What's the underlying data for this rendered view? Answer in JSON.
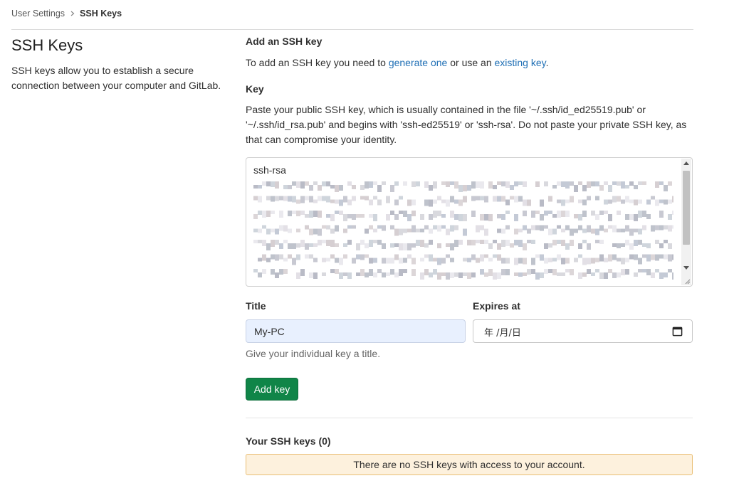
{
  "breadcrumb": {
    "parent": "User Settings",
    "current": "SSH Keys"
  },
  "sidebar": {
    "title": "SSH Keys",
    "description": "SSH keys allow you to establish a secure connection between your computer and GitLab."
  },
  "add_key": {
    "heading": "Add an SSH key",
    "intro_prefix": "To add an SSH key you need to ",
    "generate_link": "generate one",
    "intro_middle": " or use an ",
    "existing_link": "existing key",
    "intro_suffix": ".",
    "key_label": "Key",
    "key_help": "Paste your public SSH key, which is usually contained in the file '~/.ssh/id_ed25519.pub' or '~/.ssh/id_rsa.pub' and begins with 'ssh-ed25519' or 'ssh-rsa'. Do not paste your private SSH key, as that can compromise your identity.",
    "key_value": "ssh-rsa",
    "title_label": "Title",
    "title_value": "My-PC",
    "title_hint": "Give your individual key a title.",
    "expires_label": "Expires at",
    "expires_placeholder": "年 /月/日",
    "submit_label": "Add key"
  },
  "keys_list": {
    "heading": "Your SSH keys (0)",
    "empty_message": "There are no SSH keys with access to your account."
  },
  "colors": {
    "accent_link": "#1f6fb5",
    "primary_button": "#108548",
    "warning_bg": "#fdf1dd",
    "warning_border": "#e9be74",
    "autofill_bg": "#e8f0fe"
  },
  "icons": {
    "breadcrumb_separator": "chevron-right-icon",
    "date_picker": "calendar-icon",
    "textarea_resize": "resize-grip-icon"
  }
}
